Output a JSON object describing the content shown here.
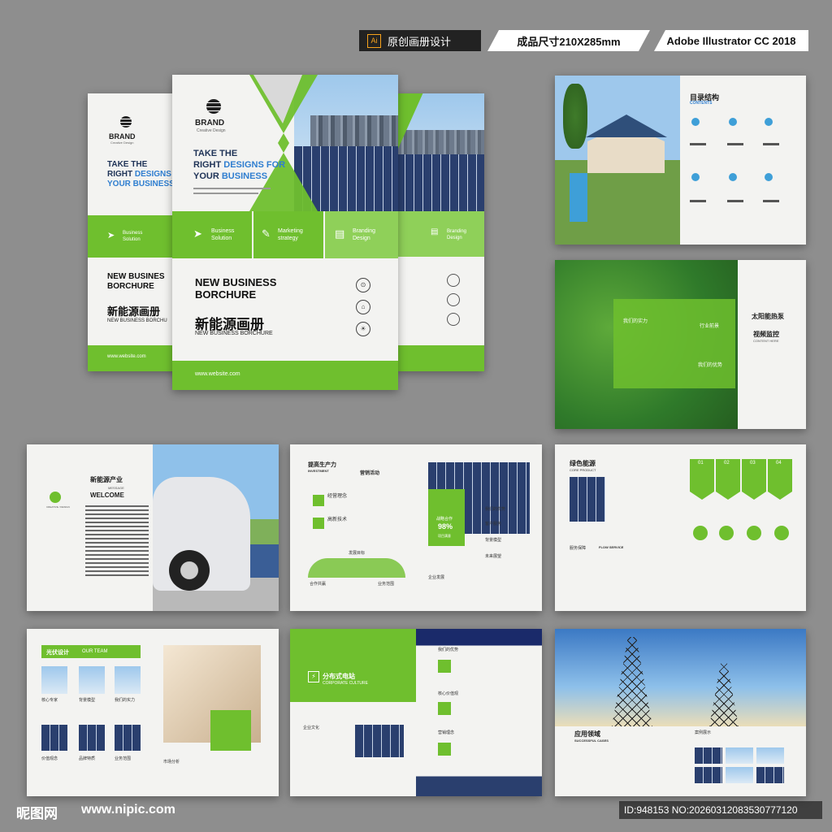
{
  "header": {
    "ai_badge": "Ai",
    "original_label": "原创画册设计",
    "size_label": "成品尺寸210X285mm",
    "software_label": "Adobe Illustrator CC 2018"
  },
  "cover": {
    "brand": "BRAND",
    "brand_sub": "Creative Design",
    "headline_1": "TAKE THE",
    "headline_2a": "RIGHT ",
    "headline_2b": "DESIGNS FOR",
    "headline_3a": "YOUR ",
    "headline_3b": "BUSINESS",
    "feature_1a": "Business",
    "feature_1b": "Solution",
    "feature_2a": "Marketing",
    "feature_2b": "strategy",
    "feature_3a": "Branding",
    "feature_3b": "Design",
    "title_1": "NEW BUSINESS",
    "title_2": "BORCHURE",
    "title_back_1": "NEW BUSINES",
    "title_cn": "新能源画册",
    "title_cn_back": "新能源画册",
    "subtitle": "NEW BUSINESS BORCHURE",
    "subtitle_back": "NEW BUSINESS BORCHU",
    "website": "www.website.com",
    "back_head_1": "TAKE THE",
    "back_head_2a": "RIGHT ",
    "back_head_2b": "DESIGNS FO",
    "back_head_3": "YOUR BUSINESS"
  },
  "spreads": {
    "contents_title": "目录结构",
    "contents_sub": "CONTENTS",
    "solar_pump": "太阳能热泵",
    "video_monitor": "视频监控",
    "content_here": "CONTENT HERE",
    "our_strength": "我们的实力",
    "industry_advantage": "行业前景",
    "our_advantage": "我们的优势",
    "ne_industry": "新能源产业",
    "message": "MESSAGE",
    "welcome": "WELCOME",
    "creative_design": "CREATIVE / DESIGN",
    "productivity": "提高生产力",
    "investment": "INVESTMENT",
    "marketing": "营销活动",
    "biz_philosophy": "经营理念",
    "hi_tech": "高新技术",
    "dev_goal": "发展目标",
    "coop": "合作共赢",
    "biz_scope": "业务范围",
    "strategic_coop": "战略合作",
    "percent": "98%",
    "satisfaction": "项目满意",
    "customer_service": "客户服务",
    "bg_model": "背景模型",
    "future_vision": "未来展望",
    "enterprise_dev": "企业发展",
    "green_energy": "绿色能源",
    "core_product": "CORE PRODUCT",
    "service_guarantee": "服务保障",
    "flow_service": "FLOW SERVICE",
    "step_01": "01",
    "step_02": "02",
    "step_03": "03",
    "step_04": "04",
    "pv_design": "光伏设计",
    "our_team": "OUR TEAM",
    "core_expert": "核心专家",
    "bg_model2": "背景模型",
    "our_strength2": "我们的实力",
    "value_concept": "价值观念",
    "brand_feature": "品牌特质",
    "biz_scope2": "业务范围",
    "market_analysis": "市场分析",
    "distributed_station": "分布式电站",
    "corporate_culture": "CORPORATE CULTURE",
    "enterprise_culture": "企业文化",
    "our_advantage2": "我们的优势",
    "core_value": "核心价值观",
    "marketing_idea": "营销理念",
    "application_field": "应用领域",
    "successful_cases": "SUCCESSFUL CASES",
    "case_show": "案例展示"
  },
  "watermark": {
    "site_logo": "昵图网",
    "site_url": "www.nipic.com",
    "id_text": "ID:948153 NO:20260312083530777120"
  },
  "colors": {
    "accent": "#6fbf2e",
    "dark": "#222222",
    "blue": "#3e9fd8"
  }
}
